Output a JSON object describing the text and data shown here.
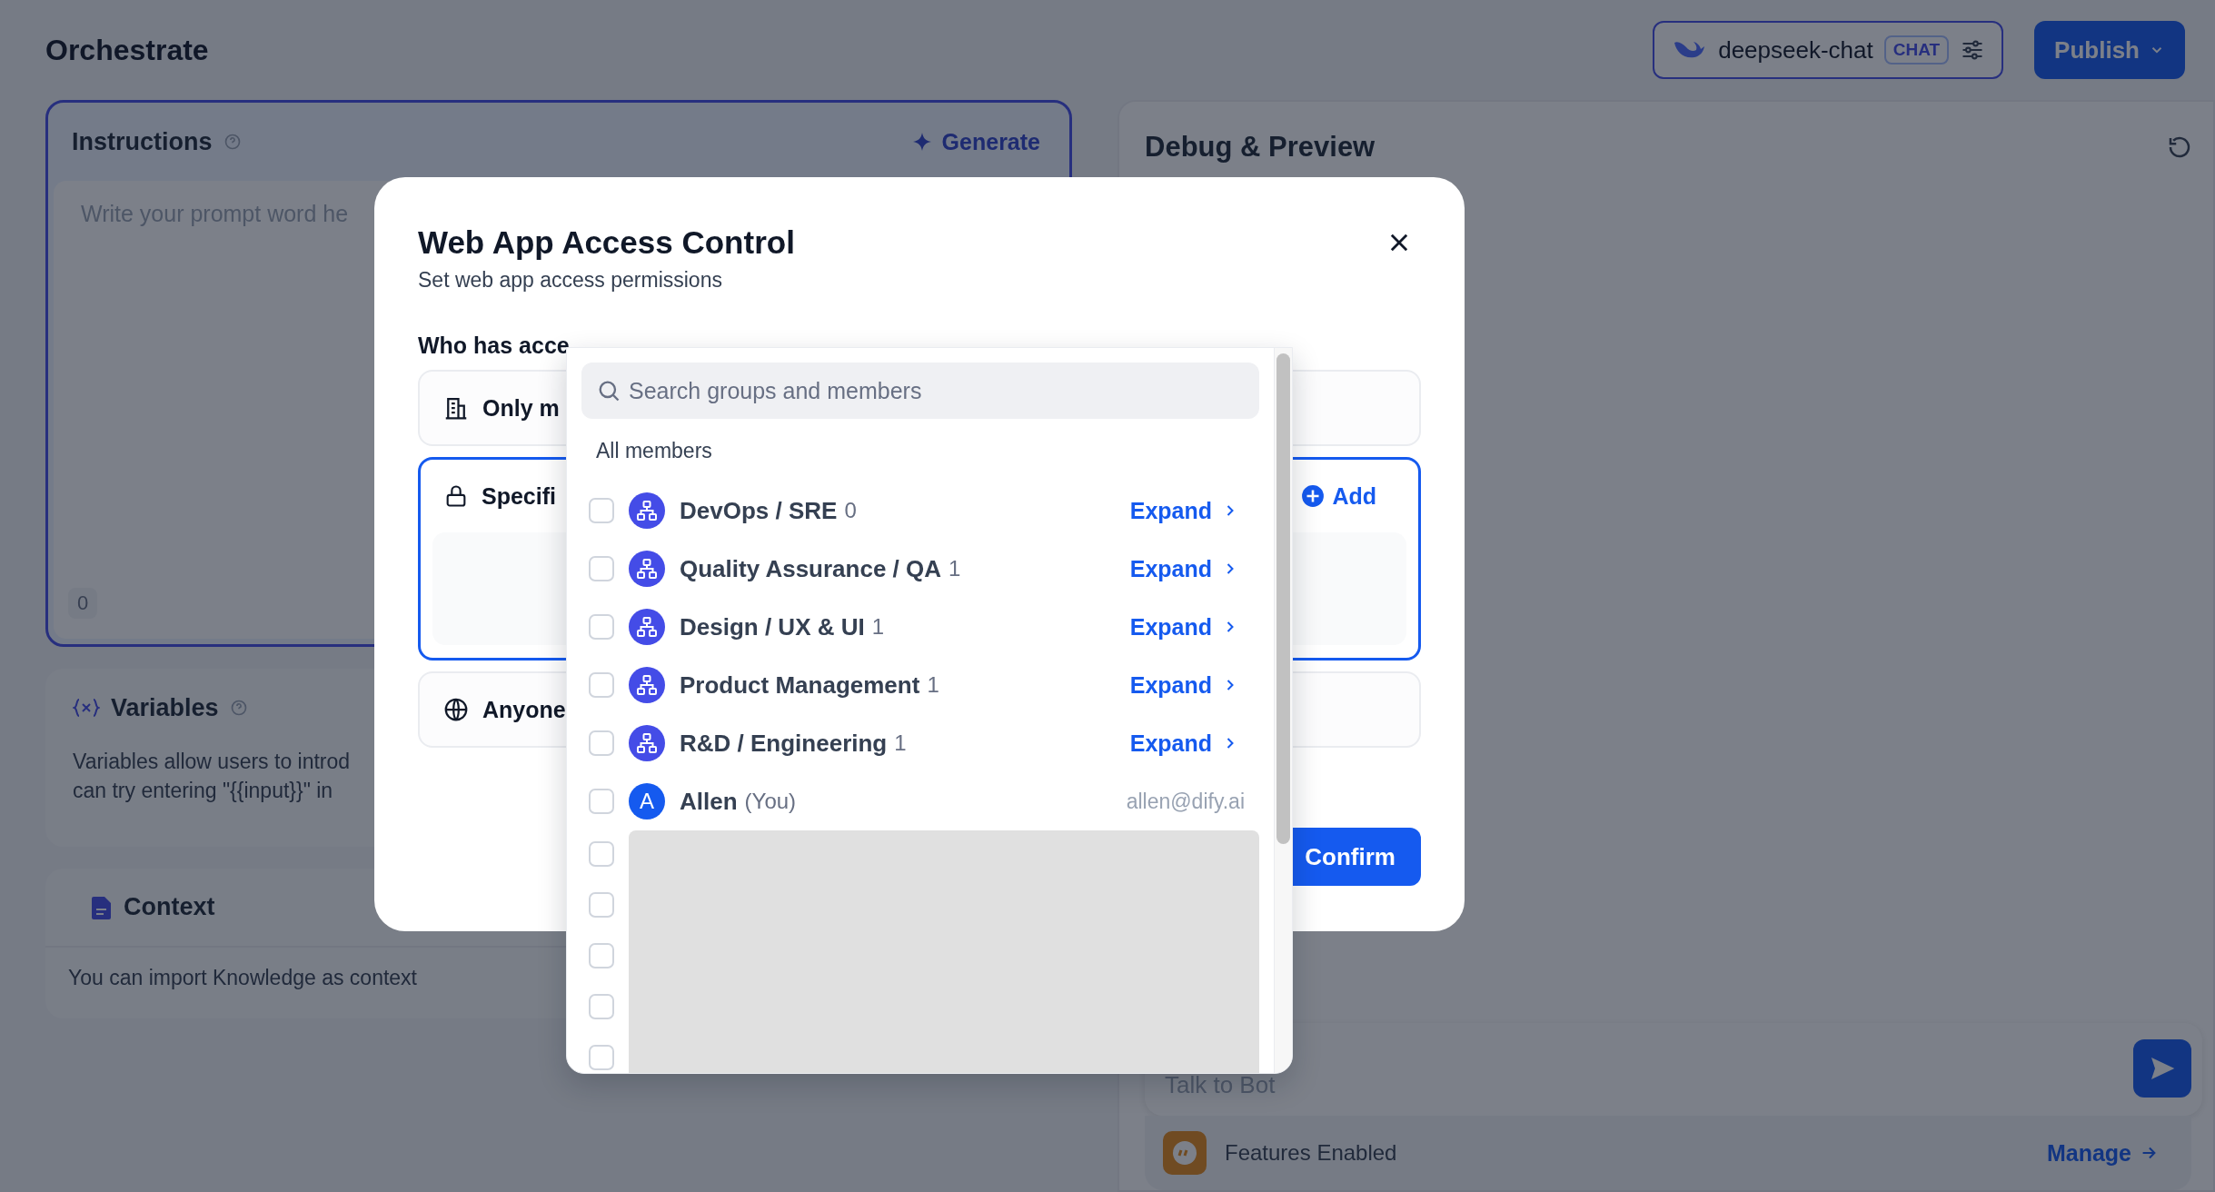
{
  "page": {
    "title": "Orchestrate"
  },
  "model": {
    "name": "deepseek-chat",
    "mode": "CHAT"
  },
  "publish": {
    "label": "Publish"
  },
  "instructions": {
    "title": "Instructions",
    "generate": "Generate",
    "placeholder": "Write your prompt word he",
    "count": "0"
  },
  "variables": {
    "title": "Variables",
    "text": [
      "Variables allow users to introd",
      "can try entering \"{{input}}\" in"
    ]
  },
  "context": {
    "title": "Context",
    "text": "You can import Knowledge as context"
  },
  "debug": {
    "title": "Debug & Preview",
    "chat_placeholder": "Talk to Bot",
    "features": "Features Enabled",
    "manage": "Manage"
  },
  "dialog": {
    "title": "Web App Access Control",
    "subtitle": "Set web app access permissions",
    "question": "Who has acce",
    "options": [
      {
        "kind": "organization",
        "label": "Only m",
        "selected": false
      },
      {
        "kind": "specific",
        "label": "Specifi",
        "selected": true,
        "add": "Add"
      },
      {
        "kind": "anyone",
        "label": "Anyone",
        "selected": false
      }
    ],
    "confirm": "Confirm"
  },
  "picker": {
    "search_placeholder": "Search groups and members",
    "section": "All members",
    "rows": [
      {
        "kind": "group",
        "name": "DevOps / SRE",
        "count": "0",
        "action": "Expand",
        "checked": false
      },
      {
        "kind": "group",
        "name": "Quality Assurance / QA",
        "count": "1",
        "action": "Expand",
        "checked": false
      },
      {
        "kind": "group",
        "name": "Design / UX & UI",
        "count": "1",
        "action": "Expand",
        "checked": false
      },
      {
        "kind": "group",
        "name": "Product Management",
        "count": "1",
        "action": "Expand",
        "checked": false
      },
      {
        "kind": "group",
        "name": "R&D / Engineering",
        "count": "1",
        "action": "Expand",
        "checked": false
      },
      {
        "kind": "member",
        "initial": "A",
        "name": "Allen",
        "note": "(You)",
        "email": "allen@dify.ai",
        "checked": false
      },
      {
        "kind": "loading",
        "checked": false
      },
      {
        "kind": "loading",
        "checked": false
      },
      {
        "kind": "loading",
        "checked": false
      },
      {
        "kind": "loading",
        "checked": false
      },
      {
        "kind": "loading",
        "checked": false
      }
    ]
  }
}
